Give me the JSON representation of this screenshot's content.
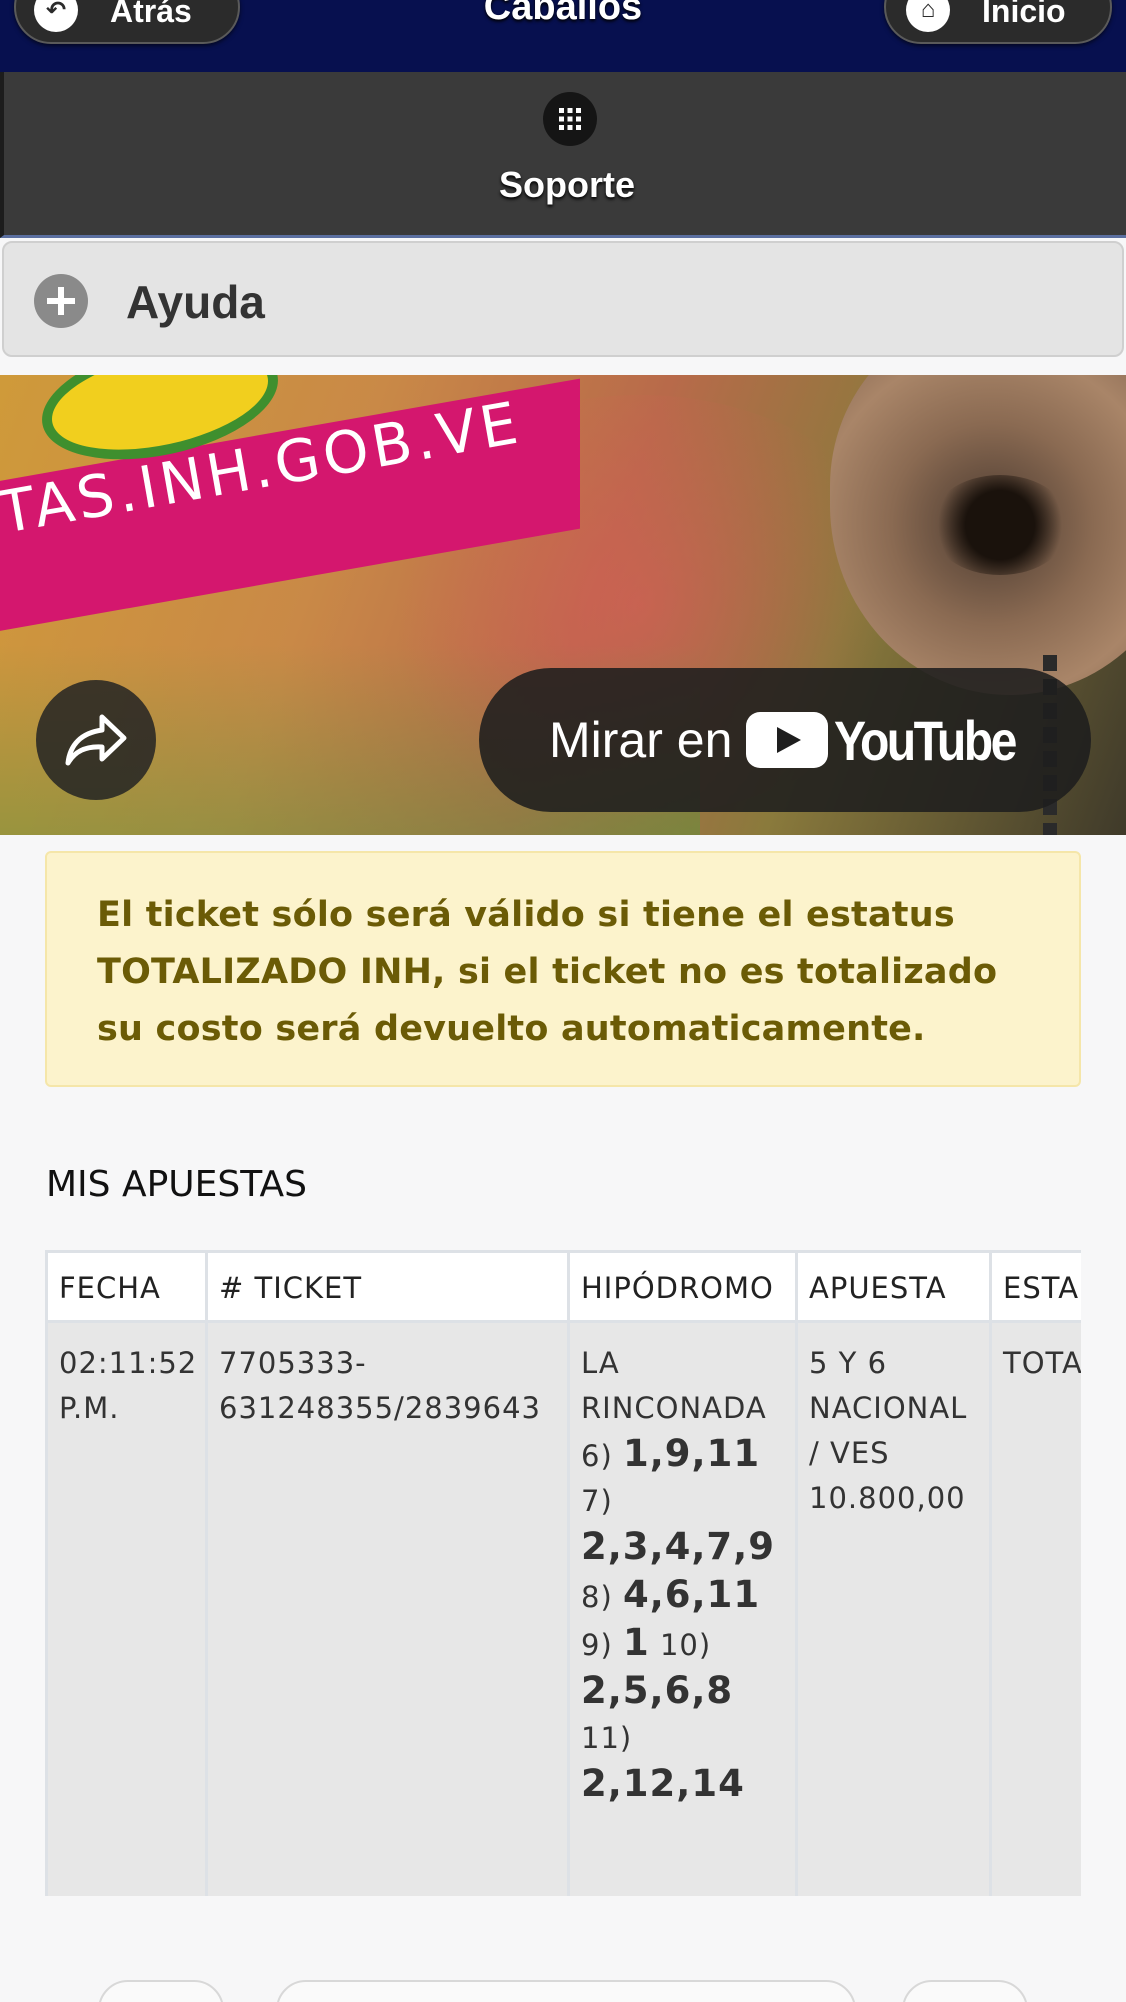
{
  "header": {
    "back_label": "Atrás",
    "title": "Caballos",
    "home_label": "Inicio",
    "bg_color": "#07104f"
  },
  "soporte": {
    "label": "Soporte",
    "icon": "grid-icon"
  },
  "ayuda": {
    "label": "Ayuda",
    "icon": "plus-circle-icon"
  },
  "video": {
    "banner_text": "TAS.INH.GOB.VE",
    "watch_label": "Mirar en",
    "platform_label": "YouTube",
    "share_icon": "share-arrow-icon"
  },
  "alert": {
    "text": "El ticket sólo será válido si tiene el estatus TOTALIZADO INH, si el ticket no es totalizado su costo será devuelto automaticamente.",
    "color": "#6b5b06"
  },
  "bets": {
    "title": "MIS APUESTAS",
    "columns": [
      "FECHA",
      "# TICKET",
      "HIPÓDROMO",
      "APUESTA",
      "ESTA"
    ],
    "rows": [
      {
        "fecha": "02:11:52 P.M.",
        "ticket": "7705333-631248355/2839643",
        "hipodromo": "LA RINCONADA",
        "picks": [
          {
            "race": "6)",
            "horses": "1,9,11"
          },
          {
            "race": "7)",
            "horses": "2,3,4,7,9"
          },
          {
            "race": "8)",
            "horses": "4,6,11"
          },
          {
            "race": "9)",
            "horses": "1"
          },
          {
            "race": "10)",
            "horses": "2,5,6,8"
          },
          {
            "race": "11)",
            "horses": "2,12,14"
          }
        ],
        "apuesta": "5 Y 6 NACIONAL / VES 10.800,00",
        "estatus": "TOTA INH"
      }
    ]
  }
}
